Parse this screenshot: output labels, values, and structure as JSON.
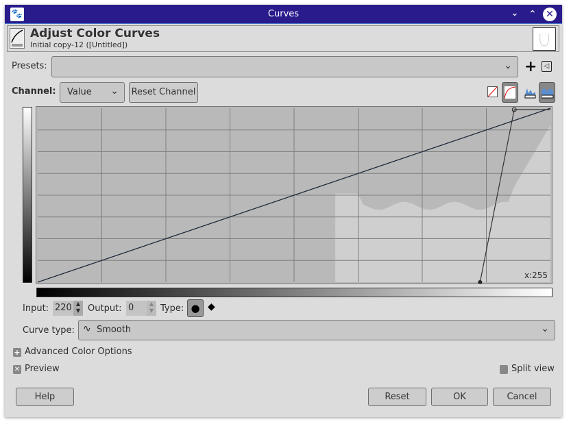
{
  "window": {
    "title": "Curves"
  },
  "header": {
    "title": "Adjust Color Curves",
    "subtitle": "Initial copy-12 ([Untitled])"
  },
  "presets": {
    "label": "Presets:",
    "value": ""
  },
  "channel": {
    "label": "Channel:",
    "value": "Value",
    "reset_label": "Reset Channel"
  },
  "graph": {
    "readout": "x:255"
  },
  "point": {
    "input_label": "Input:",
    "input_value": "220",
    "output_label": "Output:",
    "output_value": "0",
    "type_label": "Type:"
  },
  "curve_type": {
    "label": "Curve type:",
    "value": "Smooth"
  },
  "advanced": {
    "label": "Advanced Color Options"
  },
  "preview": {
    "label": "Preview",
    "checked": true
  },
  "split_view": {
    "label": "Split view",
    "checked": false
  },
  "buttons": {
    "help": "Help",
    "reset": "Reset",
    "ok": "OK",
    "cancel": "Cancel"
  },
  "curve_points": [
    [
      0,
      0
    ],
    [
      255,
      255
    ]
  ],
  "edit_points": [
    [
      220,
      0
    ],
    [
      237,
      253
    ],
    [
      255,
      253
    ]
  ],
  "colors": {
    "titlebar": "#2a1b8c",
    "graph_bg": "#b9b9b9",
    "histogram": "#cfcfcf"
  }
}
